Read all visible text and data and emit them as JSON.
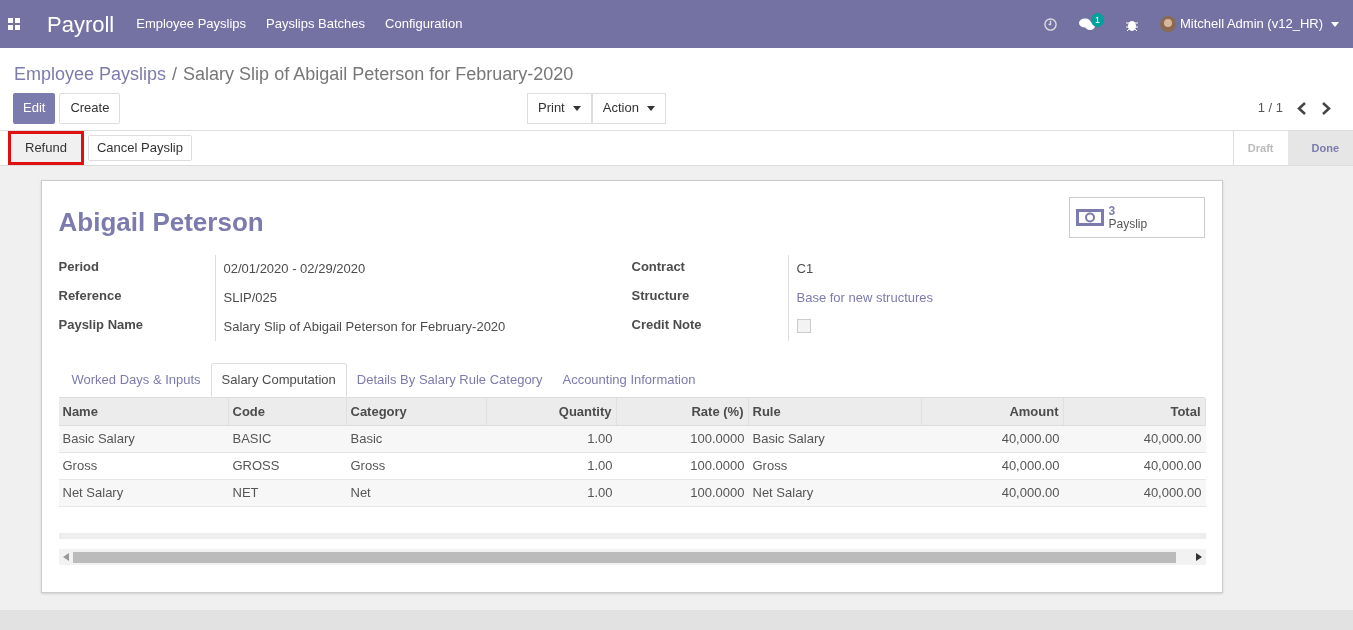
{
  "navbar": {
    "app_name": "Payroll",
    "menu": [
      "Employee Payslips",
      "Payslips Batches",
      "Configuration"
    ],
    "message_count": "1",
    "user": "Mitchell Admin (v12_HR)"
  },
  "breadcrumb": {
    "parent": "Employee Payslips",
    "separator": "/",
    "current": "Salary Slip of Abigail Peterson for February-2020"
  },
  "control_buttons": [
    {
      "label": "Edit",
      "kind": "primary"
    },
    {
      "label": "Create",
      "kind": "secondary"
    }
  ],
  "dropdowns": [
    "Print",
    "Action"
  ],
  "pager": "1 / 1",
  "header_buttons": [
    {
      "label": "Refund",
      "highlighted": true
    },
    {
      "label": "Cancel Payslip",
      "highlighted": false
    }
  ],
  "status_steps": [
    {
      "label": "Draft",
      "selected": false
    },
    {
      "label": "Done",
      "selected": true
    }
  ],
  "form": {
    "title": "Abigail Peterson",
    "smart_button": {
      "count": "3",
      "label": "Payslip"
    },
    "left_fields": [
      {
        "label": "Period",
        "value": "02/01/2020 - 02/29/2020",
        "kind": "text"
      },
      {
        "label": "Reference",
        "value": "SLIP/025",
        "kind": "text"
      },
      {
        "label": "Payslip Name",
        "value": "Salary Slip of Abigail Peterson for February-2020",
        "kind": "text"
      }
    ],
    "right_fields": [
      {
        "label": "Contract",
        "value": "C1",
        "kind": "text"
      },
      {
        "label": "Structure",
        "value": "Base for new structures",
        "kind": "link"
      },
      {
        "label": "Credit Note",
        "kind": "checkbox",
        "checked": false
      }
    ],
    "tabs": [
      {
        "label": "Worked Days & Inputs",
        "selected": false
      },
      {
        "label": "Salary Computation",
        "selected": true
      },
      {
        "label": "Details By Salary Rule Category",
        "selected": false
      },
      {
        "label": "Accounting Information",
        "selected": false
      }
    ],
    "table": {
      "columns": [
        {
          "label": "Name",
          "kind": "text"
        },
        {
          "label": "Code",
          "kind": "text"
        },
        {
          "label": "Category",
          "kind": "text"
        },
        {
          "label": "Quantity",
          "kind": "number"
        },
        {
          "label": "Rate (%)",
          "kind": "number"
        },
        {
          "label": "Rule",
          "kind": "text"
        },
        {
          "label": "Amount",
          "kind": "number"
        },
        {
          "label": "Total",
          "kind": "number"
        }
      ],
      "rows": [
        [
          "Basic Salary",
          "BASIC",
          "Basic",
          "1.00",
          "100.0000",
          "Basic Salary",
          "40,000.00",
          "40,000.00"
        ],
        [
          "Gross",
          "GROSS",
          "Gross",
          "1.00",
          "100.0000",
          "Gross",
          "40,000.00",
          "40,000.00"
        ],
        [
          "Net Salary",
          "NET",
          "Net",
          "1.00",
          "100.0000",
          "Net Salary",
          "40,000.00",
          "40,000.00"
        ]
      ]
    }
  }
}
